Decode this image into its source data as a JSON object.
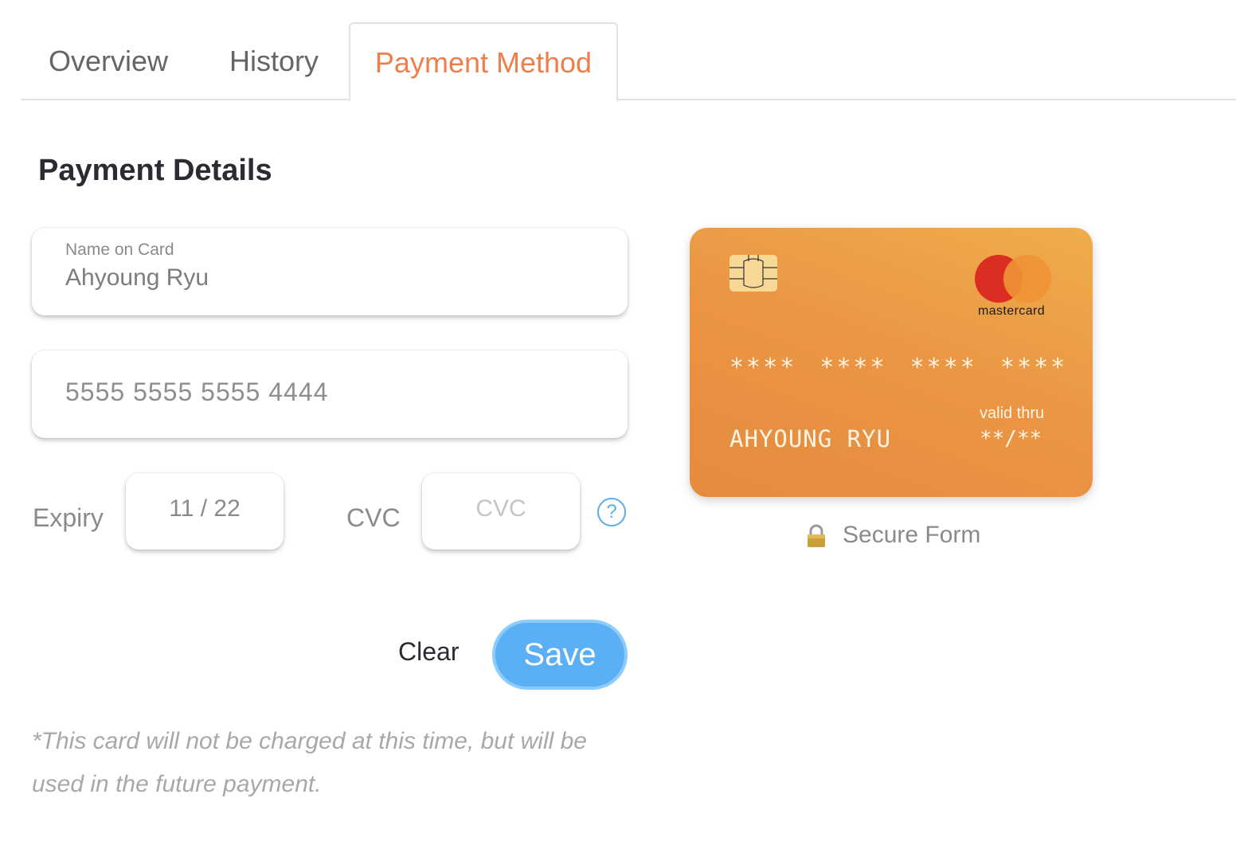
{
  "tabs": [
    {
      "label": "Overview"
    },
    {
      "label": "History"
    },
    {
      "label": "Payment Method"
    }
  ],
  "form": {
    "title": "Payment Details",
    "name_label": "Name on Card",
    "name_value": "Ahyoung Ryu",
    "card_number": "5555 5555 5555 4444",
    "expiry_label": "Expiry",
    "expiry_value": "11 / 22",
    "cvc_label": "CVC",
    "cvc_placeholder": "CVC",
    "help_symbol": "?",
    "clear_label": "Clear",
    "save_label": "Save",
    "note": "*This card will not be charged at this time, but will be used in the future payment."
  },
  "card": {
    "brand": "mastercard",
    "masked_number": "**** **** **** ****",
    "holder": "AHYOUNG RYU",
    "valid_label": "valid thru",
    "valid_value": "**/**"
  },
  "secure": {
    "label": "Secure Form",
    "icon": "lock-icon"
  },
  "colors": {
    "accent": "#ee7f4c",
    "save_button": "#5aaff5",
    "card_gradient_start": "#efad4a",
    "card_gradient_end": "#e58b3f"
  }
}
